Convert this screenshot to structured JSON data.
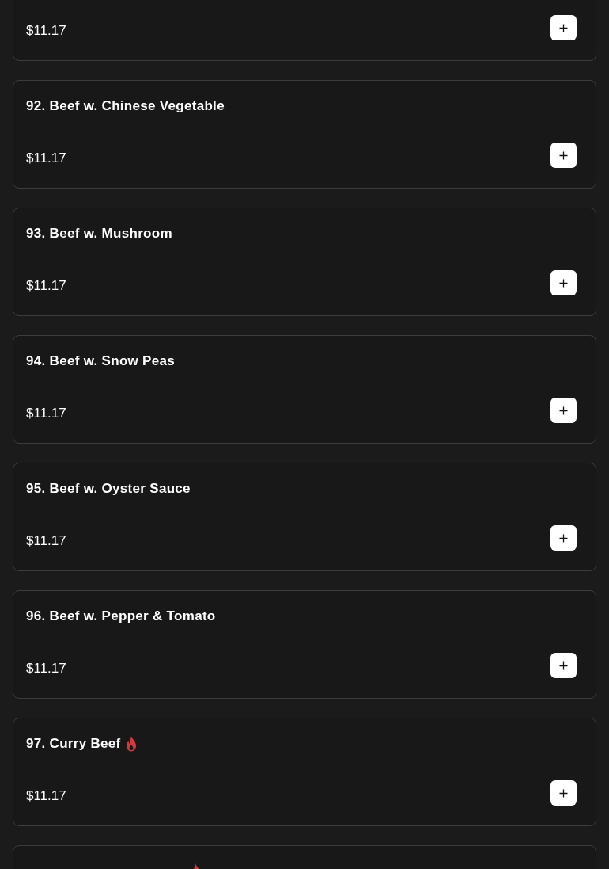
{
  "items": [
    {
      "price": "$11.17"
    },
    {
      "name": "92. Beef w. Chinese Vegetable",
      "price": "$11.17",
      "spicy": false
    },
    {
      "name": "93. Beef w. Mushroom",
      "price": "$11.17",
      "spicy": false
    },
    {
      "name": "94. Beef w. Snow Peas",
      "price": "$11.17",
      "spicy": false
    },
    {
      "name": "95. Beef w. Oyster Sauce",
      "price": "$11.17",
      "spicy": false
    },
    {
      "name": "96. Beef w. Pepper & Tomato",
      "price": "$11.17",
      "spicy": false
    },
    {
      "name": "97. Curry Beef",
      "price": "$11.17",
      "spicy": true
    },
    {
      "spicy": true
    }
  ]
}
